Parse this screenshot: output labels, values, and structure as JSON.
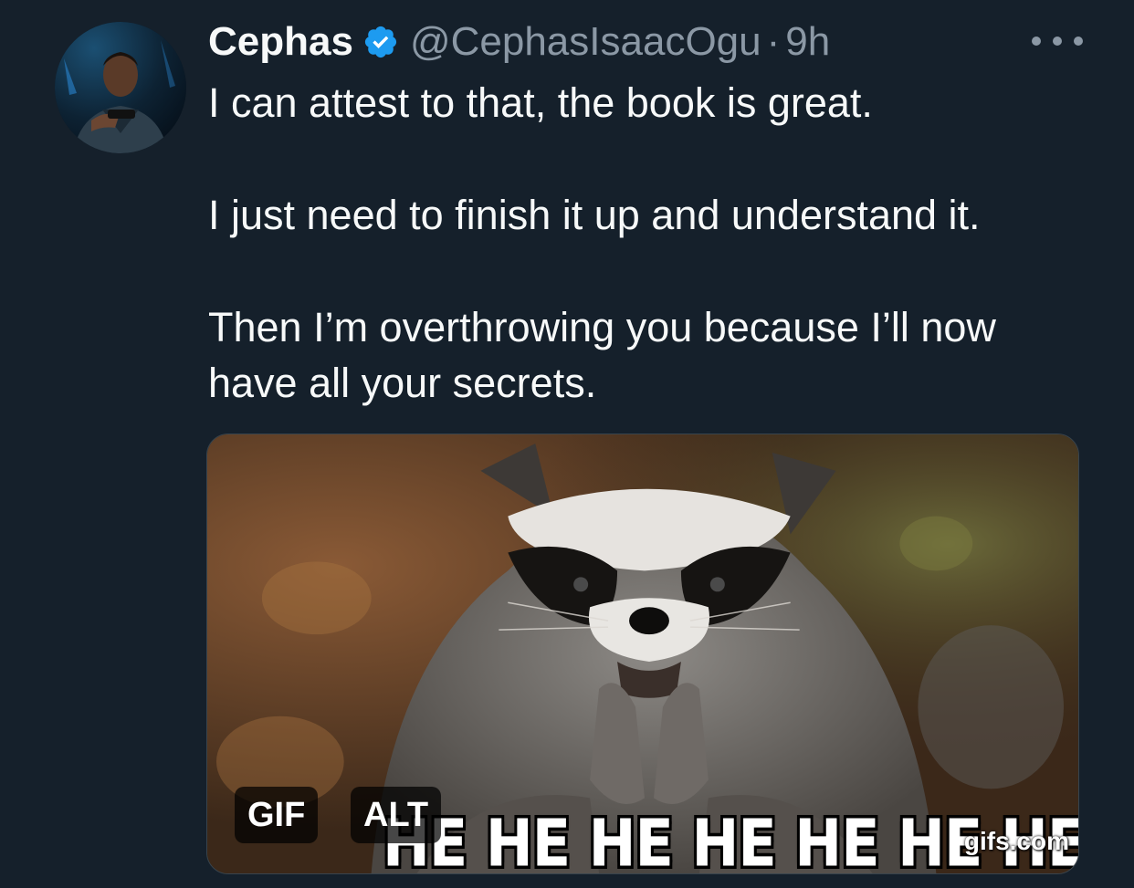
{
  "author": {
    "display_name": "Cephas",
    "handle": "@CephasIsaacOgu",
    "separator": "·",
    "timestamp": "9h",
    "verified": true,
    "verified_color": "#1d9bf0"
  },
  "tweet": {
    "paragraphs": [
      "I can attest to that, the book is great.",
      "I just need to finish it up and understand it.",
      "Then I’m overthrowing you because I’ll now have all your secrets."
    ]
  },
  "media": {
    "type": "gif",
    "caption": "HE HE HE HE HE HE HE",
    "watermark": "gifs.com",
    "badges": {
      "gif_label": "GIF",
      "alt_label": "ALT"
    }
  },
  "icons": {
    "more": "more-dots-icon",
    "verified": "verified-badge-icon"
  },
  "colors": {
    "background": "#15202b",
    "text_primary": "#f7f9f9",
    "text_secondary": "#8b98a5"
  }
}
